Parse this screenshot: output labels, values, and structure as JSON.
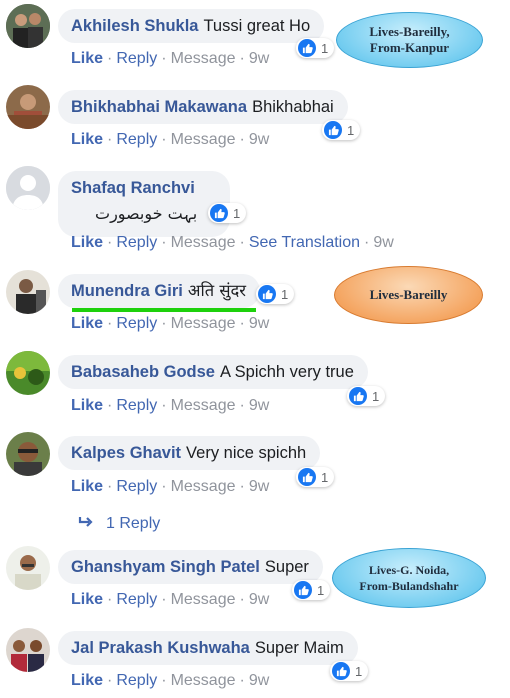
{
  "comments": [
    {
      "name": "Akhilesh Shukla",
      "text": "Tussi great Ho",
      "likes": "1",
      "actions": {
        "like": "Like",
        "reply": "Reply",
        "message": "Message",
        "time": "9w"
      }
    },
    {
      "name": "Bhikhabhai Makawana",
      "text": "Bhikhabhai",
      "likes": "1",
      "actions": {
        "like": "Like",
        "reply": "Reply",
        "message": "Message",
        "time": "9w"
      }
    },
    {
      "name": "Shafaq Ranchvi",
      "text": "بہت خوبصورت",
      "likes": "1",
      "actions": {
        "like": "Like",
        "reply": "Reply",
        "message": "Message",
        "see_translation": "See Translation",
        "time": "9w"
      }
    },
    {
      "name": "Munendra Giri",
      "text": "अति सुंदर",
      "likes": "1",
      "actions": {
        "like": "Like",
        "reply": "Reply",
        "message": "Message",
        "time": "9w"
      }
    },
    {
      "name": "Babasaheb Godse",
      "text": "A Spichh very true",
      "likes": "1",
      "actions": {
        "like": "Like",
        "reply": "Reply",
        "message": "Message",
        "time": "9w"
      }
    },
    {
      "name": "Kalpes Ghavit",
      "text": "Very nice spichh",
      "likes": "1",
      "actions": {
        "like": "Like",
        "reply": "Reply",
        "message": "Message",
        "time": "9w"
      }
    },
    {
      "name": "Ghanshyam Singh Patel",
      "text": "Super",
      "likes": "1",
      "actions": {
        "like": "Like",
        "reply": "Reply",
        "message": "Message",
        "time": "9w"
      }
    },
    {
      "name": "Jal Prakash Kushwaha",
      "text": "Super Maim",
      "likes": "1",
      "actions": {
        "like": "Like",
        "reply": "Reply",
        "message": "Message",
        "time": "9w"
      }
    }
  ],
  "replies_link": "1 Reply",
  "callouts": [
    {
      "line1": "Lives-Bareilly,",
      "line2": "From-Kanpur"
    },
    {
      "line1": "Lives-Bareilly",
      "line2": ""
    },
    {
      "line1": "Lives-G. Noida,",
      "line2": "From-Bulandshahr"
    }
  ],
  "colors": {
    "name": "#385898",
    "action_link": "#4267b2",
    "meta": "#90949c",
    "bubble": "#f0f2f5",
    "like": "#1877f2",
    "highlight": "#1ed10c"
  },
  "icons": {
    "like": "thumbs-up-icon",
    "reply_arrow": "reply-arrow-icon"
  }
}
